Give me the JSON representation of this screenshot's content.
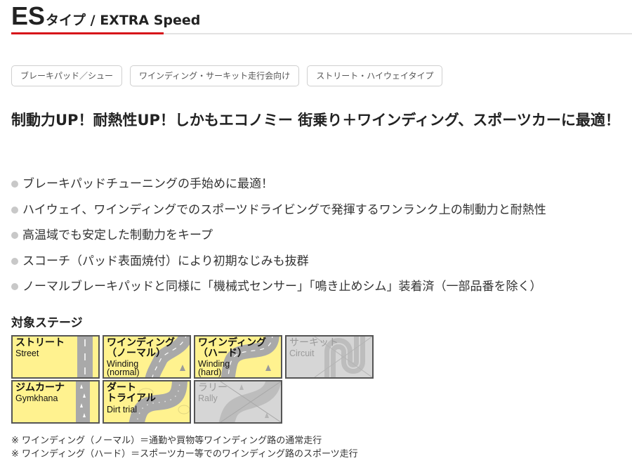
{
  "title": {
    "main": "ES",
    "suffix": "タイプ / EXTRA Speed",
    "accent_color": "#d7141a"
  },
  "tags": [
    {
      "label": "ブレーキパッド／シュー"
    },
    {
      "label": "ワインディング・サーキット走行会向け"
    },
    {
      "label": "ストリート・ハイウェイタイプ"
    }
  ],
  "headline": "制動力UP！耐熱性UP！しかもエコノミー 街乗り＋ワインディング、スポーツカーに最適！",
  "features": [
    {
      "text": "ブレーキパッドチューニングの手始めに最適！"
    },
    {
      "text": "ハイウェイ、ワインディングでのスポーツドライビングで発揮するワンランク上の制動力と耐熱性"
    },
    {
      "text": "高温域でも安定した制動力をキープ"
    },
    {
      "text": "スコーチ（パッド表面焼付）により初期なじみも抜群"
    },
    {
      "text": "ノーマルブレーキパッドと同様に「機械式センサー」「鳴き止めシム」装着済（一部品番を除く）"
    }
  ],
  "stages": {
    "heading": "対象ステージ",
    "items": [
      {
        "key": "street",
        "jp1": "ストリート",
        "jp2": "",
        "en1": "Street",
        "en2": "",
        "active": true
      },
      {
        "key": "winding-normal",
        "jp1": "ワインディング",
        "jp2": "（ノーマル）",
        "en1": "Winding",
        "en2": "(normal)",
        "active": true
      },
      {
        "key": "winding-hard",
        "jp1": "ワインディング",
        "jp2": "（ハード）",
        "en1": "Winding",
        "en2": "(hard)",
        "active": true
      },
      {
        "key": "circuit",
        "jp1": "サーキット",
        "jp2": "",
        "en1": "Circuit",
        "en2": "",
        "active": false
      },
      {
        "key": "gymkhana",
        "jp1": "ジムカーナ",
        "jp2": "",
        "en1": "Gymkhana",
        "en2": "",
        "active": true
      },
      {
        "key": "dirt-trial",
        "jp1": "ダート",
        "jp2": "トライアル",
        "en1": "Dirt trial",
        "en2": "",
        "active": true
      },
      {
        "key": "rally",
        "jp1": "ラリー",
        "jp2": "",
        "en1": "Rally",
        "en2": "",
        "active": false
      }
    ]
  },
  "notes": [
    "※ ワインディング（ノーマル）＝通勤や買物等ワインディング路の通常走行",
    "※ ワインディング（ハード）＝スポーツカー等でのワインディング路のスポーツ走行"
  ]
}
